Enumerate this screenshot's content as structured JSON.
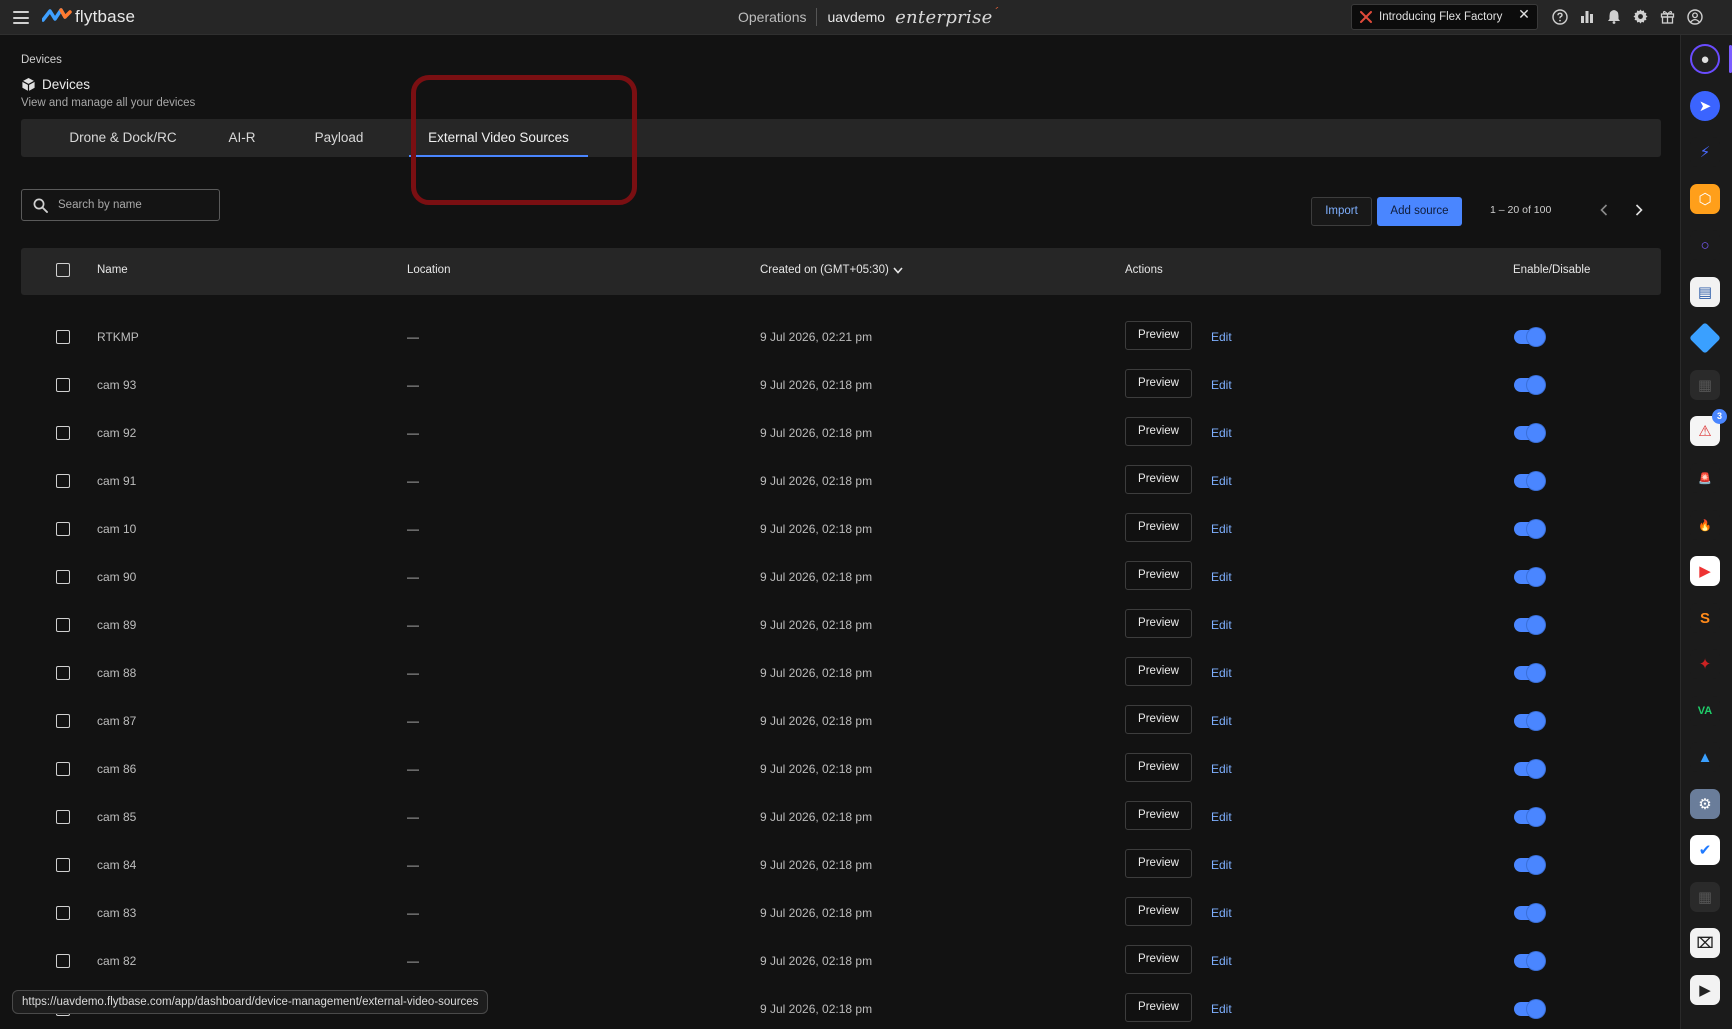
{
  "topbar": {
    "brand": "flytbase",
    "section": "Operations",
    "org": "uavdemo",
    "plan": "enterprise",
    "promo_text": "Introducing Flex Factory",
    "promo_close": "✕",
    "icons": [
      "help-icon",
      "analytics-icon",
      "bell-icon",
      "gear-icon",
      "gift-icon",
      "account-icon"
    ]
  },
  "page": {
    "breadcrumb": "Devices",
    "title": "Devices",
    "subtitle": "View and manage all your devices"
  },
  "tabs": [
    {
      "label": "Drone & Dock/RC"
    },
    {
      "label": "AI-R"
    },
    {
      "label": "Payload"
    },
    {
      "label": "External Video Sources"
    }
  ],
  "active_tab": "External Video Sources",
  "search": {
    "placeholder": "Search by name",
    "value": ""
  },
  "toolbar": {
    "import_label": "Import",
    "add_label": "Add source"
  },
  "pagination": {
    "range": "1 – 20 of 100"
  },
  "table": {
    "columns": {
      "name": "Name",
      "location": "Location",
      "created": "Created on (GMT+05:30)",
      "actions": "Actions",
      "enable": "Enable/Disable"
    },
    "preview_label": "Preview",
    "edit_label": "Edit",
    "rows": [
      {
        "name": "RTKMP",
        "location": "—",
        "created": "9 Jul 2026, 02:21 pm",
        "enabled": true
      },
      {
        "name": "cam 93",
        "location": "—",
        "created": "9 Jul 2026, 02:18 pm",
        "enabled": true
      },
      {
        "name": "cam 92",
        "location": "—",
        "created": "9 Jul 2026, 02:18 pm",
        "enabled": true
      },
      {
        "name": "cam 91",
        "location": "—",
        "created": "9 Jul 2026, 02:18 pm",
        "enabled": true
      },
      {
        "name": "cam 10",
        "location": "—",
        "created": "9 Jul 2026, 02:18 pm",
        "enabled": true
      },
      {
        "name": "cam 90",
        "location": "—",
        "created": "9 Jul 2026, 02:18 pm",
        "enabled": true
      },
      {
        "name": "cam 89",
        "location": "—",
        "created": "9 Jul 2026, 02:18 pm",
        "enabled": true
      },
      {
        "name": "cam 88",
        "location": "—",
        "created": "9 Jul 2026, 02:18 pm",
        "enabled": true
      },
      {
        "name": "cam 87",
        "location": "—",
        "created": "9 Jul 2026, 02:18 pm",
        "enabled": true
      },
      {
        "name": "cam 86",
        "location": "—",
        "created": "9 Jul 2026, 02:18 pm",
        "enabled": true
      },
      {
        "name": "cam 85",
        "location": "—",
        "created": "9 Jul 2026, 02:18 pm",
        "enabled": true
      },
      {
        "name": "cam 84",
        "location": "—",
        "created": "9 Jul 2026, 02:18 pm",
        "enabled": true
      },
      {
        "name": "cam 83",
        "location": "—",
        "created": "9 Jul 2026, 02:18 pm",
        "enabled": true
      },
      {
        "name": "cam 82",
        "location": "—",
        "created": "9 Jul 2026, 02:18 pm",
        "enabled": true
      },
      {
        "name": "",
        "location": "",
        "created": "9 Jul 2026, 02:18 pm",
        "enabled": true
      }
    ]
  },
  "rail": {
    "badge_count": "3",
    "apps": [
      "app-avatar-icon",
      "app-send-icon",
      "app-bolt-icon",
      "app-hex-icon",
      "app-ring-icon",
      "app-genetec-icon",
      "app-diamond-icon",
      "app-grid-icon",
      "app-siren-badge-icon",
      "app-alarm-icon",
      "app-fire-icon",
      "app-camera-icon",
      "app-s-icon",
      "app-logo-icon",
      "app-va-icon",
      "app-triangle-icon",
      "app-robot-icon",
      "app-check-icon",
      "app-grid2-icon",
      "app-cctv-icon",
      "app-player-icon"
    ]
  },
  "status_url": "https://uavdemo.flytbase.com/app/dashboard/device-management/external-video-sources",
  "colors": {
    "accent": "#4a86ff",
    "highlight": "#7a0f12",
    "background": "#121212"
  }
}
